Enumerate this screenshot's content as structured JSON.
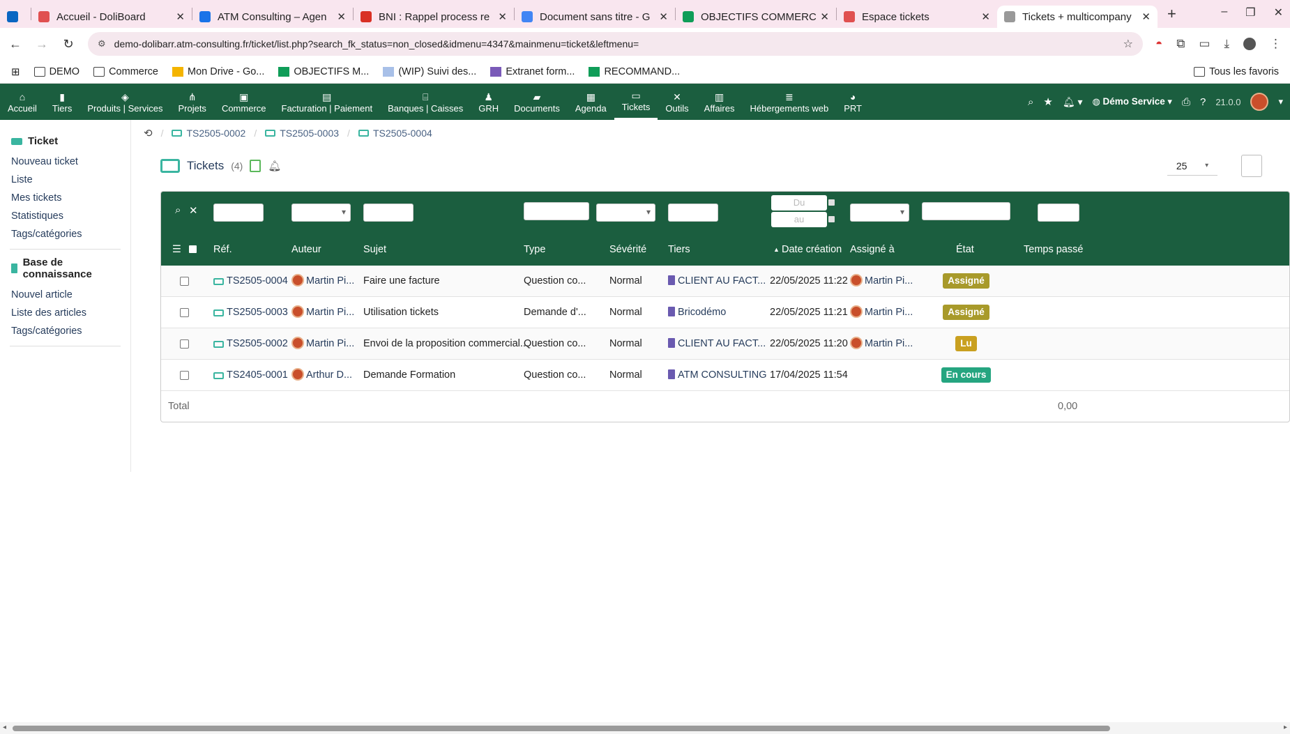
{
  "browser": {
    "tabs": [
      {
        "title": "",
        "icon": "linkedin-icon",
        "color": "#0a66c2"
      },
      {
        "title": "Accueil - DoliBoard",
        "icon": "atm-icon",
        "color": "#e05050"
      },
      {
        "title": "ATM Consulting – Agen",
        "icon": "calendar-icon",
        "color": "#1a73e8"
      },
      {
        "title": "BNI : Rappel process re",
        "icon": "gmail-icon",
        "color": "#d93025"
      },
      {
        "title": "Document sans titre - G",
        "icon": "docs-icon",
        "color": "#4285f4"
      },
      {
        "title": "OBJECTIFS COMMERCI",
        "icon": "sheets-icon",
        "color": "#0f9d58"
      },
      {
        "title": "Espace tickets",
        "icon": "atm-icon",
        "color": "#e05050"
      },
      {
        "title": "Tickets + multicompany",
        "icon": "loading-icon",
        "color": "#999999"
      }
    ],
    "new_tab": "+",
    "url": "demo-dolibarr.atm-consulting.fr/ticket/list.php?search_fk_status=non_closed&idmenu=4347&mainmenu=ticket&leftmenu=",
    "bookmarks": [
      {
        "label": "DEMO",
        "icon": "folder-icon"
      },
      {
        "label": "Commerce",
        "icon": "folder-icon"
      },
      {
        "label": "Mon Drive - Go...",
        "icon": "drive-icon"
      },
      {
        "label": "OBJECTIFS M...",
        "icon": "sheets-icon"
      },
      {
        "label": "(WIP) Suivi des...",
        "icon": "mail-icon"
      },
      {
        "label": "Extranet form...",
        "icon": "extranet-icon"
      },
      {
        "label": "RECOMMAND...",
        "icon": "sheets-icon"
      }
    ],
    "bookmarks_all": "Tous les favoris"
  },
  "topmenu": {
    "items": [
      {
        "label": "Accueil",
        "icon": "home-icon",
        "glyph": "⌂"
      },
      {
        "label": "Tiers",
        "icon": "building-icon",
        "glyph": "▮"
      },
      {
        "label": "Produits | Services",
        "icon": "cube-icon",
        "glyph": "◈"
      },
      {
        "label": "Projets",
        "icon": "sitemap-icon",
        "glyph": "⋔"
      },
      {
        "label": "Commerce",
        "icon": "briefcase-icon",
        "glyph": "▣"
      },
      {
        "label": "Facturation | Paiement",
        "icon": "invoice-icon",
        "glyph": "▤"
      },
      {
        "label": "Banques | Caisses",
        "icon": "bank-icon",
        "glyph": "⌸"
      },
      {
        "label": "GRH",
        "icon": "user-tie-icon",
        "glyph": "♟"
      },
      {
        "label": "Documents",
        "icon": "folder-open-icon",
        "glyph": "▰"
      },
      {
        "label": "Agenda",
        "icon": "calendar-icon",
        "glyph": "▦"
      },
      {
        "label": "Tickets",
        "icon": "ticket-icon",
        "glyph": "▭"
      },
      {
        "label": "Outils",
        "icon": "tools-icon",
        "glyph": "✕"
      },
      {
        "label": "Affaires",
        "icon": "toolbox-icon",
        "glyph": "▥"
      },
      {
        "label": "Hébergements web",
        "icon": "server-icon",
        "glyph": "≣"
      },
      {
        "label": "PRT",
        "icon": "chart-icon",
        "glyph": "◕"
      }
    ],
    "active_index": 10,
    "entity": "Démo Service",
    "version": "21.0.0"
  },
  "leftmenu": {
    "section1_title": "Ticket",
    "section1_links": [
      "Nouveau ticket",
      "Liste",
      "Mes tickets",
      "Statistiques",
      "Tags/catégories"
    ],
    "section2_title": "Base de connaissance",
    "section2_links": [
      "Nouvel article",
      "Liste des articles",
      "Tags/catégories"
    ]
  },
  "breadcrumb": [
    "TS2505-0002",
    "TS2505-0003",
    "TS2505-0004"
  ],
  "page": {
    "title": "Tickets",
    "count": "(4)",
    "per_page": "25"
  },
  "filters": {
    "date_from_placeholder": "Du",
    "date_to_placeholder": "au"
  },
  "columns": {
    "ref": "Réf.",
    "author": "Auteur",
    "subject": "Sujet",
    "type": "Type",
    "severity": "Sévérité",
    "thirdparty": "Tiers",
    "date": "Date création",
    "assigned": "Assigné à",
    "status": "État",
    "time": "Temps passé"
  },
  "rows": [
    {
      "ref": "TS2505-0004",
      "author": "Martin Pi...",
      "subject": "Faire une facture",
      "type": "Question co...",
      "severity": "Normal",
      "thirdparty": "CLIENT AU FACT...",
      "date": "22/05/2025 11:22",
      "assigned": "Martin Pi...",
      "status": "Assigné",
      "status_color": "#a89a2a"
    },
    {
      "ref": "TS2505-0003",
      "author": "Martin Pi...",
      "subject": "Utilisation tickets",
      "type": "Demande d'...",
      "severity": "Normal",
      "thirdparty": "Bricodémo",
      "date": "22/05/2025 11:21",
      "assigned": "Martin Pi...",
      "status": "Assigné",
      "status_color": "#a89a2a"
    },
    {
      "ref": "TS2505-0002",
      "author": "Martin Pi...",
      "subject": "Envoi de la proposition commercial...",
      "type": "Question co...",
      "severity": "Normal",
      "thirdparty": "CLIENT AU FACT...",
      "date": "22/05/2025 11:20",
      "assigned": "Martin Pi...",
      "status": "Lu",
      "status_color": "#c9a020"
    },
    {
      "ref": "TS2405-0001",
      "author": "Arthur D...",
      "subject": "Demande Formation",
      "type": "Question co...",
      "severity": "Normal",
      "thirdparty": "ATM CONSULTING",
      "date": "17/04/2025 11:54",
      "assigned": "",
      "status": "En cours",
      "status_color": "#25a580"
    }
  ],
  "total": {
    "label": "Total",
    "value": "0,00"
  }
}
